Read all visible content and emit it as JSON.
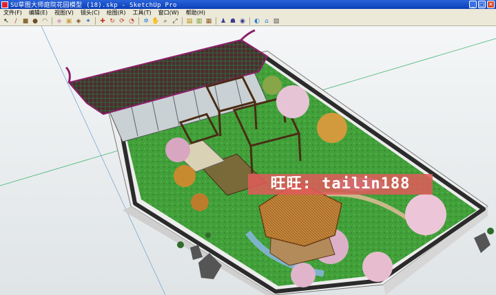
{
  "window": {
    "title": "SU草图大师庭院花园模型 (18).skp - SketchUp Pro",
    "minimize_label": "_",
    "maximize_label": "□",
    "close_label": "✕"
  },
  "menu": [
    "文件(F)",
    "编辑(E)",
    "视图(V)",
    "镜头(C)",
    "绘图(R)",
    "工具(T)",
    "窗口(W)",
    "帮助(H)"
  ],
  "toolbar": [
    {
      "name": "select",
      "glyph": "↖",
      "color": "#000"
    },
    {
      "name": "pencil",
      "glyph": "/",
      "color": "#c0392b"
    },
    {
      "name": "rectangle",
      "glyph": "■",
      "color": "#8b6b3a"
    },
    {
      "name": "circle",
      "glyph": "●",
      "color": "#6b4e2b"
    },
    {
      "name": "arc",
      "glyph": "◠",
      "color": "#7a5f2b"
    },
    {
      "name": "eraser",
      "glyph": "◆",
      "color": "#d9a7c7"
    },
    {
      "name": "tape",
      "glyph": "▣",
      "color": "#c9a24a"
    },
    {
      "name": "paint",
      "glyph": "◈",
      "color": "#7a4f2a"
    },
    {
      "name": "push-pull",
      "glyph": "✦",
      "color": "#3b6ecf"
    },
    {
      "name": "move",
      "glyph": "✚",
      "color": "#c0392b"
    },
    {
      "name": "rotate",
      "glyph": "↻",
      "color": "#c0392b"
    },
    {
      "name": "follow-me",
      "glyph": "⟳",
      "color": "#c0392b"
    },
    {
      "name": "offset",
      "glyph": "◔",
      "color": "#c0392b"
    },
    {
      "name": "orbit",
      "glyph": "✲",
      "color": "#2c7bd6"
    },
    {
      "name": "pan",
      "glyph": "✋",
      "color": "#333"
    },
    {
      "name": "zoom",
      "glyph": "⌕",
      "color": "#333"
    },
    {
      "name": "zoom-extents",
      "glyph": "⤢",
      "color": "#333"
    },
    {
      "name": "layers",
      "glyph": "▤",
      "color": "#b8860b"
    },
    {
      "name": "components",
      "glyph": "▥",
      "color": "#6f8f2b"
    },
    {
      "name": "materials",
      "glyph": "▦",
      "color": "#8a5a2b"
    },
    {
      "name": "position-camera",
      "glyph": "♟",
      "color": "#3b3b8f"
    },
    {
      "name": "walk",
      "glyph": "☗",
      "color": "#3b3b8f"
    },
    {
      "name": "look-around",
      "glyph": "◉",
      "color": "#3b3b8f"
    },
    {
      "name": "section",
      "glyph": "◐",
      "color": "#2c7bd6"
    },
    {
      "name": "geo",
      "glyph": "⌂",
      "color": "#2c7bd6"
    },
    {
      "name": "warehouse",
      "glyph": "▧",
      "color": "#555"
    }
  ],
  "watermark": "旺旺: tailin188",
  "colors": {
    "roof": "#5a2a31",
    "roof_edge": "#8c1f6b",
    "wall": "#f2f2f2",
    "wall_top": "#3a3a3a",
    "lawn": "#3f9d35",
    "path": "#c9b88a",
    "pavilion": "#c97a2e",
    "pavilion_dark": "#7a4a1a",
    "blossom": "#e8b9cf",
    "tree_orange": "#d29a3c",
    "sky_axis_green": "#3cb371",
    "sky_axis_red": "#d23"
  }
}
